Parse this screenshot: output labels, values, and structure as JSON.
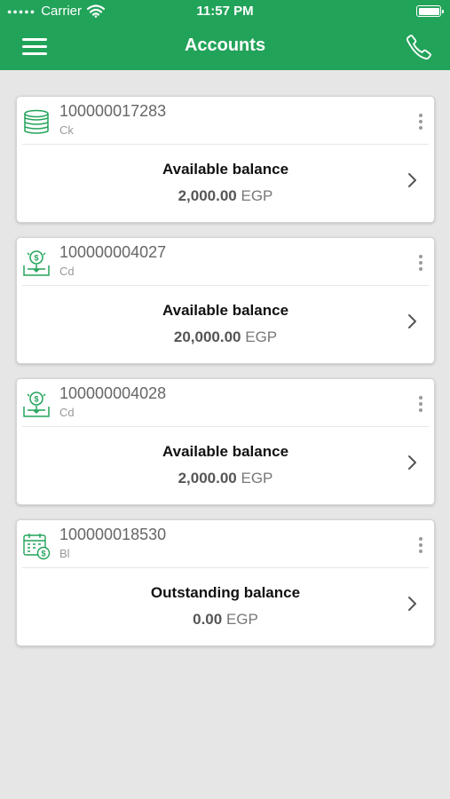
{
  "status_bar": {
    "carrier": "Carrier",
    "time": "11:57 PM",
    "icons": [
      "signal-dots-icon",
      "wifi-icon",
      "battery-icon"
    ]
  },
  "nav_bar": {
    "title": "Accounts",
    "icons": [
      "menu-icon",
      "phone-icon"
    ]
  },
  "colors": {
    "primary": "#22a35a",
    "background": "#e6e6e6",
    "card": "#ffffff"
  },
  "accounts": [
    {
      "number": "100000017283",
      "type": "Ck",
      "icon": "coins-stack-icon",
      "balance_label": "Available balance",
      "amount": "2,000.00",
      "currency": "EGP"
    },
    {
      "number": "100000004027",
      "type": "Cd",
      "icon": "money-deposit-icon",
      "balance_label": "Available balance",
      "amount": "20,000.00",
      "currency": "EGP"
    },
    {
      "number": "100000004028",
      "type": "Cd",
      "icon": "money-deposit-icon",
      "balance_label": "Available balance",
      "amount": "2,000.00",
      "currency": "EGP"
    },
    {
      "number": "100000018530",
      "type": "Bl",
      "icon": "calendar-money-icon",
      "balance_label": "Outstanding balance",
      "amount": "0.00",
      "currency": "EGP"
    }
  ]
}
